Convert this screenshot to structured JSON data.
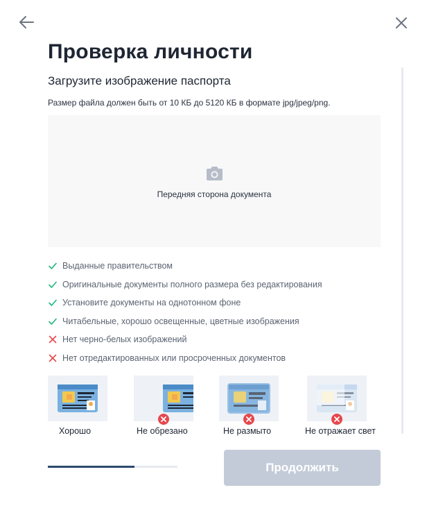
{
  "header": {
    "title": "Проверка личности",
    "subtitle": "Загрузите изображение паспорта",
    "hint": "Размер файла должен быть от 10 КБ до 5120 КБ в формате jpg/jpeg/png."
  },
  "upload": {
    "label": "Передняя сторона документа",
    "icon": "camera-icon"
  },
  "requirements": [
    {
      "text": "Выданные правительством",
      "ok": true
    },
    {
      "text": "Оригинальные документы полного размера без редактирования",
      "ok": true
    },
    {
      "text": "Установите документы на однотонном фоне",
      "ok": true
    },
    {
      "text": "Читабельные, хорошо освещенные, цветные изображения",
      "ok": true
    },
    {
      "text": "Нет черно-белых изображений",
      "ok": false
    },
    {
      "text": "Нет отредактированных или просроченных документов",
      "ok": false
    }
  ],
  "examples": [
    {
      "caption": "Хорошо",
      "ok": true
    },
    {
      "caption": "Не обрезано",
      "ok": false
    },
    {
      "caption": "Не размыто",
      "ok": false
    },
    {
      "caption": "Не отражает свет",
      "ok": false
    }
  ],
  "progress": {
    "fraction": 0.67
  },
  "buttons": {
    "continue": "Продолжить"
  },
  "colors": {
    "ok": "#1fb67a",
    "bad": "#e5484d",
    "accent": "#2c4a6e",
    "disabled": "#c3cbd8"
  }
}
